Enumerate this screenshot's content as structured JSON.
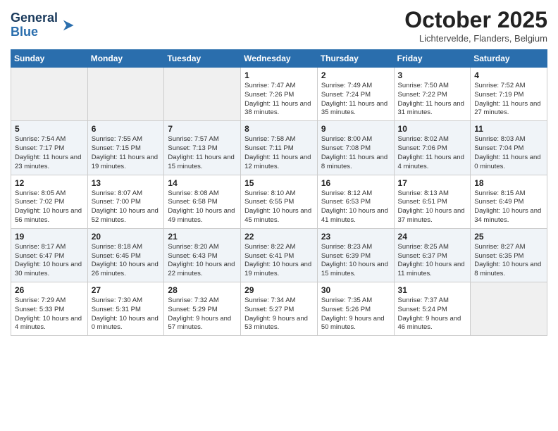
{
  "header": {
    "logo_line1": "General",
    "logo_line2": "Blue",
    "month": "October 2025",
    "location": "Lichtervelde, Flanders, Belgium"
  },
  "days_of_week": [
    "Sunday",
    "Monday",
    "Tuesday",
    "Wednesday",
    "Thursday",
    "Friday",
    "Saturday"
  ],
  "weeks": [
    [
      {
        "day": "",
        "info": ""
      },
      {
        "day": "",
        "info": ""
      },
      {
        "day": "",
        "info": ""
      },
      {
        "day": "1",
        "info": "Sunrise: 7:47 AM\nSunset: 7:26 PM\nDaylight: 11 hours\nand 38 minutes."
      },
      {
        "day": "2",
        "info": "Sunrise: 7:49 AM\nSunset: 7:24 PM\nDaylight: 11 hours\nand 35 minutes."
      },
      {
        "day": "3",
        "info": "Sunrise: 7:50 AM\nSunset: 7:22 PM\nDaylight: 11 hours\nand 31 minutes."
      },
      {
        "day": "4",
        "info": "Sunrise: 7:52 AM\nSunset: 7:19 PM\nDaylight: 11 hours\nand 27 minutes."
      }
    ],
    [
      {
        "day": "5",
        "info": "Sunrise: 7:54 AM\nSunset: 7:17 PM\nDaylight: 11 hours\nand 23 minutes."
      },
      {
        "day": "6",
        "info": "Sunrise: 7:55 AM\nSunset: 7:15 PM\nDaylight: 11 hours\nand 19 minutes."
      },
      {
        "day": "7",
        "info": "Sunrise: 7:57 AM\nSunset: 7:13 PM\nDaylight: 11 hours\nand 15 minutes."
      },
      {
        "day": "8",
        "info": "Sunrise: 7:58 AM\nSunset: 7:11 PM\nDaylight: 11 hours\nand 12 minutes."
      },
      {
        "day": "9",
        "info": "Sunrise: 8:00 AM\nSunset: 7:08 PM\nDaylight: 11 hours\nand 8 minutes."
      },
      {
        "day": "10",
        "info": "Sunrise: 8:02 AM\nSunset: 7:06 PM\nDaylight: 11 hours\nand 4 minutes."
      },
      {
        "day": "11",
        "info": "Sunrise: 8:03 AM\nSunset: 7:04 PM\nDaylight: 11 hours\nand 0 minutes."
      }
    ],
    [
      {
        "day": "12",
        "info": "Sunrise: 8:05 AM\nSunset: 7:02 PM\nDaylight: 10 hours\nand 56 minutes."
      },
      {
        "day": "13",
        "info": "Sunrise: 8:07 AM\nSunset: 7:00 PM\nDaylight: 10 hours\nand 52 minutes."
      },
      {
        "day": "14",
        "info": "Sunrise: 8:08 AM\nSunset: 6:58 PM\nDaylight: 10 hours\nand 49 minutes."
      },
      {
        "day": "15",
        "info": "Sunrise: 8:10 AM\nSunset: 6:55 PM\nDaylight: 10 hours\nand 45 minutes."
      },
      {
        "day": "16",
        "info": "Sunrise: 8:12 AM\nSunset: 6:53 PM\nDaylight: 10 hours\nand 41 minutes."
      },
      {
        "day": "17",
        "info": "Sunrise: 8:13 AM\nSunset: 6:51 PM\nDaylight: 10 hours\nand 37 minutes."
      },
      {
        "day": "18",
        "info": "Sunrise: 8:15 AM\nSunset: 6:49 PM\nDaylight: 10 hours\nand 34 minutes."
      }
    ],
    [
      {
        "day": "19",
        "info": "Sunrise: 8:17 AM\nSunset: 6:47 PM\nDaylight: 10 hours\nand 30 minutes."
      },
      {
        "day": "20",
        "info": "Sunrise: 8:18 AM\nSunset: 6:45 PM\nDaylight: 10 hours\nand 26 minutes."
      },
      {
        "day": "21",
        "info": "Sunrise: 8:20 AM\nSunset: 6:43 PM\nDaylight: 10 hours\nand 22 minutes."
      },
      {
        "day": "22",
        "info": "Sunrise: 8:22 AM\nSunset: 6:41 PM\nDaylight: 10 hours\nand 19 minutes."
      },
      {
        "day": "23",
        "info": "Sunrise: 8:23 AM\nSunset: 6:39 PM\nDaylight: 10 hours\nand 15 minutes."
      },
      {
        "day": "24",
        "info": "Sunrise: 8:25 AM\nSunset: 6:37 PM\nDaylight: 10 hours\nand 11 minutes."
      },
      {
        "day": "25",
        "info": "Sunrise: 8:27 AM\nSunset: 6:35 PM\nDaylight: 10 hours\nand 8 minutes."
      }
    ],
    [
      {
        "day": "26",
        "info": "Sunrise: 7:29 AM\nSunset: 5:33 PM\nDaylight: 10 hours\nand 4 minutes."
      },
      {
        "day": "27",
        "info": "Sunrise: 7:30 AM\nSunset: 5:31 PM\nDaylight: 10 hours\nand 0 minutes."
      },
      {
        "day": "28",
        "info": "Sunrise: 7:32 AM\nSunset: 5:29 PM\nDaylight: 9 hours\nand 57 minutes."
      },
      {
        "day": "29",
        "info": "Sunrise: 7:34 AM\nSunset: 5:27 PM\nDaylight: 9 hours\nand 53 minutes."
      },
      {
        "day": "30",
        "info": "Sunrise: 7:35 AM\nSunset: 5:26 PM\nDaylight: 9 hours\nand 50 minutes."
      },
      {
        "day": "31",
        "info": "Sunrise: 7:37 AM\nSunset: 5:24 PM\nDaylight: 9 hours\nand 46 minutes."
      },
      {
        "day": "",
        "info": ""
      }
    ]
  ]
}
